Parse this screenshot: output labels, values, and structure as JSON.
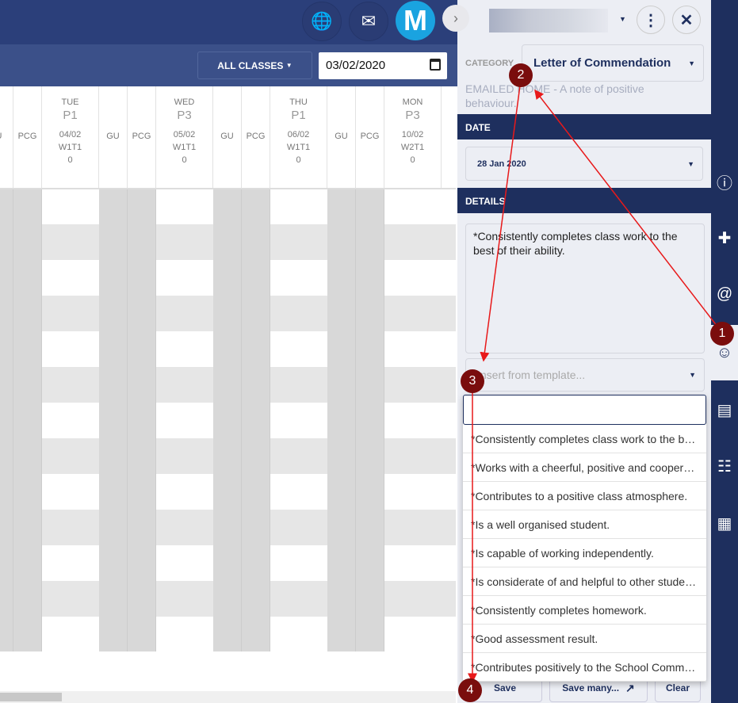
{
  "topbar": {
    "avatar_letter": "M",
    "icons": [
      "globe-icon",
      "mail-send-icon"
    ]
  },
  "toolbar": {
    "classes_label": "ALL CLASSES",
    "date_value": "03/02/2020"
  },
  "grid": {
    "columns": [
      {
        "type": "sub",
        "label": "U"
      },
      {
        "type": "sub",
        "label": "PCG"
      },
      {
        "type": "day",
        "day": "TUE",
        "period": "P1",
        "date": "04/02",
        "week": "W1T1",
        "count": "0"
      },
      {
        "type": "sub",
        "label": "GU"
      },
      {
        "type": "sub",
        "label": "PCG"
      },
      {
        "type": "day",
        "day": "WED",
        "period": "P3",
        "date": "05/02",
        "week": "W1T1",
        "count": "0"
      },
      {
        "type": "sub",
        "label": "GU"
      },
      {
        "type": "sub",
        "label": "PCG"
      },
      {
        "type": "day",
        "day": "THU",
        "period": "P1",
        "date": "06/02",
        "week": "W1T1",
        "count": "0"
      },
      {
        "type": "sub",
        "label": "GU"
      },
      {
        "type": "sub",
        "label": "PCG"
      },
      {
        "type": "day",
        "day": "MON",
        "period": "P3",
        "date": "10/02",
        "week": "W2T1",
        "count": "0"
      }
    ]
  },
  "panel": {
    "category_label": "CATEGORY",
    "category_value": "Letter of Commendation",
    "category_description": "EMAILED HOME - A note of positive behaviour.",
    "date_section": "DATE",
    "date_value": "28 Jan 2020",
    "details_section": "DETAILS",
    "details_text": "*Consistently completes class work to the best of their ability.",
    "template_placeholder": "Insert from template...",
    "template_options": [
      "*Consistently completes class work to the best of their ability.",
      "*Works with a cheerful, positive and cooperative attitude.",
      "*Contributes to a positive class atmosphere.",
      "*Is a well organised student.",
      "*Is capable of working independently.",
      "*Is considerate of and helpful to other students.",
      "*Consistently completes homework.",
      "*Good assessment result.",
      "*Contributes positively to the School Community."
    ],
    "save_label": "Save",
    "save_many_label": "Save many...",
    "clear_label": "Clear"
  },
  "annotations": {
    "markers": [
      "1",
      "2",
      "3",
      "4"
    ],
    "color": "#e8191a"
  }
}
